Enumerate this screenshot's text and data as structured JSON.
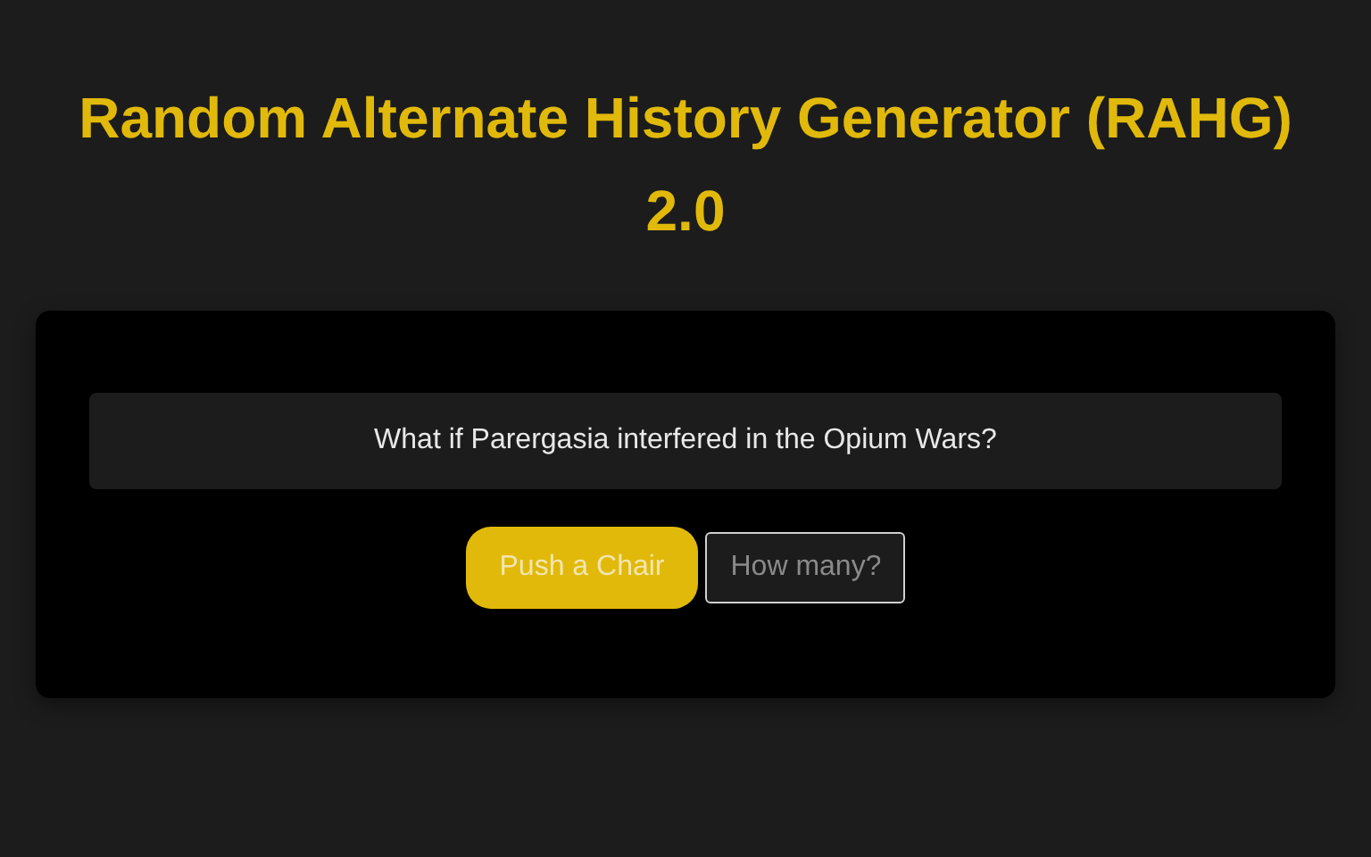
{
  "title": "Random Alternate History Generator (RAHG) 2.0",
  "question": "What if Parergasia interfered in the Opium Wars?",
  "generate_button": "Push a Chair",
  "count_field": {
    "placeholder": "How many?"
  }
}
